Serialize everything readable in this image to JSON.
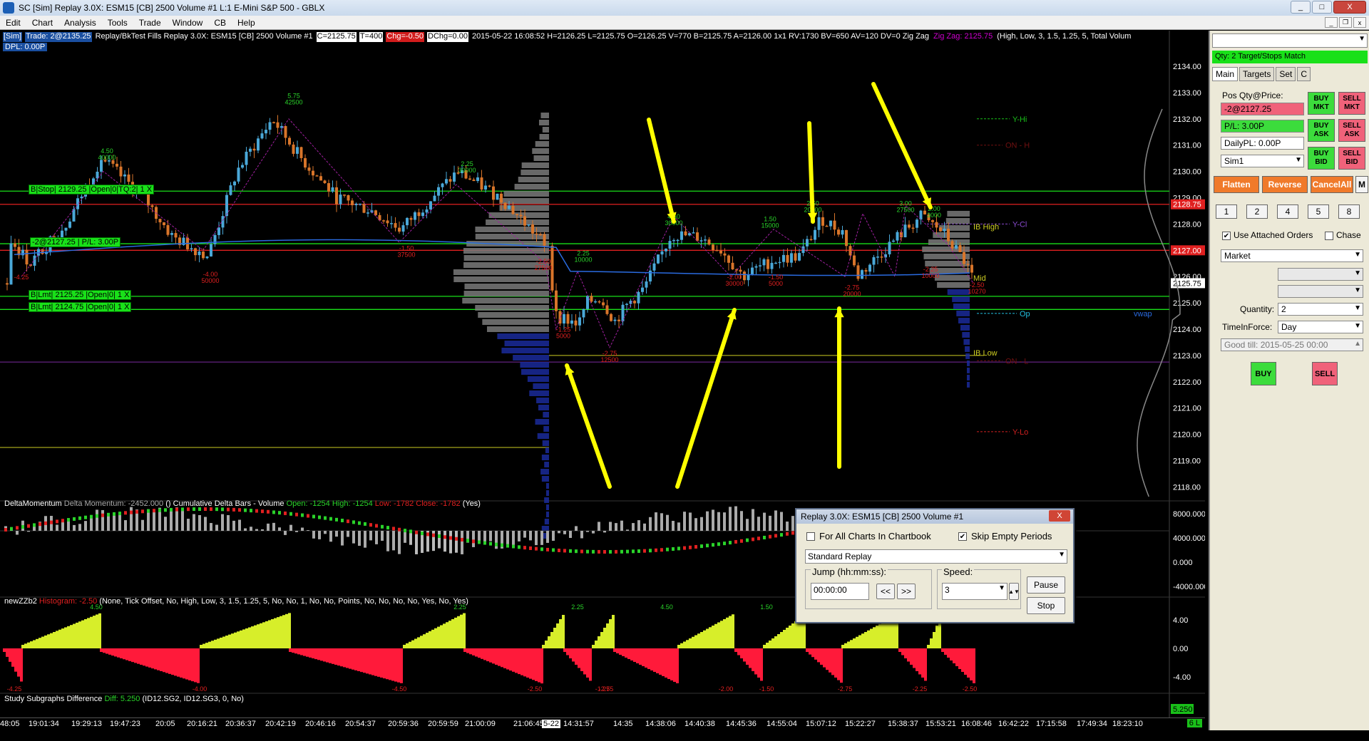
{
  "window": {
    "title": "SC [Sim] Replay 3.0X: ESM15 [CB]  2500 Volume  #1  L:1  E-Mini S&P 500 - GBLX",
    "buttons": [
      "_",
      "□",
      "X"
    ]
  },
  "menu": [
    "Edit",
    "Chart",
    "Analysis",
    "Tools",
    "Trade",
    "Window",
    "CB",
    "Help"
  ],
  "infoline": {
    "sim": "[Sim]",
    "trade": "Trade: 2@2135.25",
    "mode": "Replay/BkTest Fills  Replay 3.0X: ESM15 [CB]  2500 Volume  #1",
    "close": "C=2125.75",
    "trades": "T=400",
    "chg": "Chg=-0.50",
    "dchg": "DChg=0.00",
    "rest": "2015-05-22 16:08:52 H=2126.25 L=2125.75 O=2126.25 V=770 B=2125.75 A=2126.00 1x1 RV:1730 BV=650 AV=120 DV=0  Zig Zag",
    "zig": "Zig Zag: 2125.75",
    "params": "(High, Low, 3, 1.5, 1.25, 5, Total Volum",
    "dpl": "DPL: 0.00P"
  },
  "order_labels": {
    "stop": "B|Stop| 2129.25 |Open|0|TQ:2|  1   X",
    "position": "-2@2127.25 | P/L: 3.00P",
    "lmt1": "B|Lmt| 2125.25 |Open|0|  1   X",
    "lmt2": "B|Lmt| 2124.75 |Open|0|  1   X"
  },
  "price_axis": [
    "2134.00",
    "2133.00",
    "2132.00",
    "2131.00",
    "2130.00",
    "2129.00",
    "2128.00",
    "2127.00",
    "2126.00",
    "2125.00",
    "2124.00",
    "2123.00",
    "2122.00",
    "2121.00",
    "2120.00",
    "2119.00",
    "2118.00"
  ],
  "price_tags": {
    "red1": "2128.75",
    "red2": "2127.00",
    "current": "2125.75"
  },
  "level_labels": {
    "yhi": "Y-Hi",
    "onh": "ON - H",
    "ycl": "Y-Cl",
    "ibhigh": "IB High",
    "mid": "Mid",
    "op": "Op",
    "iblow": "IB Low",
    "onl": "ON - L",
    "ylo": "Y-Lo",
    "vwap": "vwap"
  },
  "zigzag_labels": [
    {
      "a": "4.50",
      "b": "40000"
    },
    {
      "a": "5.75",
      "b": "42500"
    },
    {
      "a": "2.25",
      "b": "30000"
    },
    {
      "a": "-4.25",
      "b": ""
    },
    {
      "a": "-4.00",
      "b": "50000"
    },
    {
      "a": "-1.50",
      "b": "37500"
    },
    {
      "a": "-2.50",
      "b": "27500"
    },
    {
      "a": "2.25",
      "b": "10000"
    },
    {
      "a": "-1.25",
      "b": "5000"
    },
    {
      "a": "-2.75",
      "b": "12500"
    },
    {
      "a": "4.50",
      "b": "30000"
    },
    {
      "a": "-2.00",
      "b": "30000"
    },
    {
      "a": "1.50",
      "b": "15000"
    },
    {
      "a": "-1.50",
      "b": "5000"
    },
    {
      "a": "2.50",
      "b": "20000"
    },
    {
      "a": "-2.75",
      "b": "20000"
    },
    {
      "a": "3.00",
      "b": "27500"
    },
    {
      "a": "2.00",
      "b": "3000"
    },
    {
      "a": "-2.25",
      "b": "10000"
    },
    {
      "a": "-2.50",
      "b": "10270"
    }
  ],
  "panel1": {
    "name": "DeltaMomentum",
    "desc": "Delta Momentum: -2452.000",
    "paren": "()",
    "cum": "Cumulative Delta Bars - Volume",
    "open": "Open: -1254",
    "high": "High: -1254",
    "low": "Low: -1782",
    "close": "Close: -1782",
    "yes": "(Yes)",
    "axis": [
      "8000.000",
      "4000.000",
      "0.000",
      "-4000.000"
    ]
  },
  "panel2": {
    "name": "newZZb2",
    "hist": "Histogram: -2.50",
    "params": "(None, Tick Offset, No, High, Low, 3, 1.5, 1.25, 5, No, No, 1, No, No, Points, No, No, No, No, Yes, No, Yes)",
    "axis": [
      "4.00",
      "0.00",
      "-4.00"
    ],
    "labels": [
      {
        "v": "4.50"
      },
      {
        "v": "-4.25"
      },
      {
        "v": "-4.00"
      },
      {
        "v": "-4.50"
      },
      {
        "v": "2.25"
      },
      {
        "v": "-2.50"
      },
      {
        "v": "2.25"
      },
      {
        "v": "-1.25"
      },
      {
        "v": "-2.75"
      },
      {
        "v": "4.50"
      },
      {
        "v": "-2.00"
      },
      {
        "v": "1.50"
      },
      {
        "v": "-1.50"
      },
      {
        "v": "2.50"
      },
      {
        "v": "-2.75"
      },
      {
        "v": "3.00"
      },
      {
        "v": "-2.25"
      },
      {
        "v": "2.00"
      },
      {
        "v": "-2.50"
      }
    ]
  },
  "panel3": {
    "name": "Study Subgraphs Difference",
    "diff": "Diff: 5.250",
    "params": "(ID12.SG2, ID12.SG3, 0, No)",
    "badge": "5.250"
  },
  "time_axis": [
    "48:05",
    "19:01:34",
    "19:29:13",
    "19:47:23",
    "20:05",
    "20:16:21",
    "20:36:37",
    "20:42:19",
    "20:46:16",
    "20:54:37",
    "20:59:36",
    "20:59:59",
    "21:00:09",
    "21:06:45",
    "5-22",
    "14:31:57",
    "14:35",
    "14:38:06",
    "14:40:38",
    "14:45:36",
    "14:55:04",
    "15:07:12",
    "15:22:27",
    "15:38:37",
    "15:53:21",
    "16:08:46",
    "16:42:22",
    "17:15:58",
    "17:49:34",
    "18:23:10"
  ],
  "time_badge": "6 L",
  "trade_panel": {
    "banner": "Qty: 2 Target/Stops Match",
    "tabs": [
      "Main",
      "Targets",
      "Set",
      "C"
    ],
    "pos_label": "Pos Qty@Price:",
    "pos_value": "-2@2127.25",
    "pl_value": "P/L: 3.00P",
    "daily_value": "DailyPL: 0.00P",
    "account": "Sim1",
    "buy_mkt": "BUY MKT",
    "sell_mkt": "SELL MKT",
    "buy_ask": "BUY ASK",
    "sell_ask": "SELL ASK",
    "buy_bid": "BUY BID",
    "sell_bid": "SELL BID",
    "flatten": "Flatten",
    "reverse": "Reverse",
    "cancel_all": "CancelAll",
    "m": "M",
    "qty_buttons": [
      "1",
      "2",
      "4",
      "5",
      "8"
    ],
    "attached": "Use Attached Orders",
    "chase": "Chase",
    "order_type": "Market",
    "qty_label": "Quantity:",
    "qty_value": "2",
    "tif_label": "TimeInForce:",
    "tif_value": "Day",
    "good_till": "Good till: 2015-05-25 00:00",
    "buy": "BUY",
    "sell": "SELL"
  },
  "replay": {
    "title": "Replay 3.0X: ESM15 [CB]  2500 Volume  #1",
    "close": "X",
    "all_charts": "For All Charts In Chartbook",
    "skip_empty": "Skip Empty Periods",
    "mode": "Standard Replay",
    "jump_label": "Jump (hh:mm:ss):",
    "jump_value": "00:00:00",
    "back": "<<",
    "fwd": ">>",
    "speed_label": "Speed:",
    "speed_value": "3",
    "pause": "Pause",
    "stop": "Stop"
  },
  "colors": {
    "up": "#4aa8d8",
    "down": "#d8752a",
    "stop_line": "#19e019",
    "red_line": "#e02020",
    "vwap": "#2a6be0",
    "arrow": "#ffff00",
    "hist_pos": "#d7ee2a",
    "hist_neg": "#ff1a3a",
    "profile": "#7a7a7a"
  }
}
